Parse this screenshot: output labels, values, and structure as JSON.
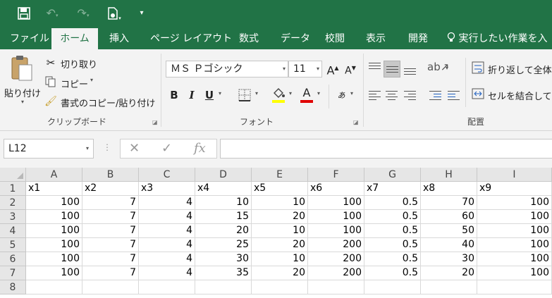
{
  "qat": {
    "save_icon": "save-icon",
    "undo_icon": "undo-icon",
    "redo_icon": "redo-icon",
    "new_icon": "new-file-icon",
    "customize_icon": "customize-icon"
  },
  "tabs": [
    "ファイル",
    "ホーム",
    "挿入",
    "ページ レイアウト",
    "数式",
    "データ",
    "校閲",
    "表示",
    "開発"
  ],
  "active_tab": "ホーム",
  "tell_me": "実行したい作業を入",
  "clipboard": {
    "paste": "貼り付け",
    "cut": "切り取り",
    "copy": "コピー",
    "format_painter": "書式のコピー/貼り付け",
    "label": "クリップボード"
  },
  "font": {
    "name": "ＭＳ Ｐゴシック",
    "size": "11",
    "grow": "A",
    "shrink": "A",
    "bold": "B",
    "italic": "I",
    "underline": "U",
    "font_color_letter": "A",
    "label": "フォント"
  },
  "alignment": {
    "wrap": "折り返して全体",
    "merge": "セルを結合して",
    "label": "配置"
  },
  "formula_bar": {
    "name_box": "L12",
    "cancel": "✕",
    "enter": "✓",
    "fx": "fx",
    "value": ""
  },
  "colors": {
    "excel_green": "#217346",
    "fill_yellow": "#ffff00",
    "font_red": "#e00000"
  },
  "sheet": {
    "columns": [
      "A",
      "B",
      "C",
      "D",
      "E",
      "F",
      "G",
      "H",
      "I"
    ],
    "rows": [
      "1",
      "2",
      "3",
      "4",
      "5",
      "6",
      "7",
      "8"
    ],
    "header": [
      "x1",
      "x2",
      "x3",
      "x4",
      "x5",
      "x6",
      "x7",
      "x8",
      "x9"
    ],
    "data": [
      [
        "100",
        "7",
        "4",
        "10",
        "10",
        "100",
        "0.5",
        "70",
        "100"
      ],
      [
        "100",
        "7",
        "4",
        "15",
        "20",
        "100",
        "0.5",
        "60",
        "100"
      ],
      [
        "100",
        "7",
        "4",
        "20",
        "10",
        "100",
        "0.5",
        "50",
        "100"
      ],
      [
        "100",
        "7",
        "4",
        "25",
        "20",
        "200",
        "0.5",
        "40",
        "100"
      ],
      [
        "100",
        "7",
        "4",
        "30",
        "10",
        "200",
        "0.5",
        "30",
        "100"
      ],
      [
        "100",
        "7",
        "4",
        "35",
        "20",
        "200",
        "0.5",
        "20",
        "100"
      ]
    ]
  }
}
